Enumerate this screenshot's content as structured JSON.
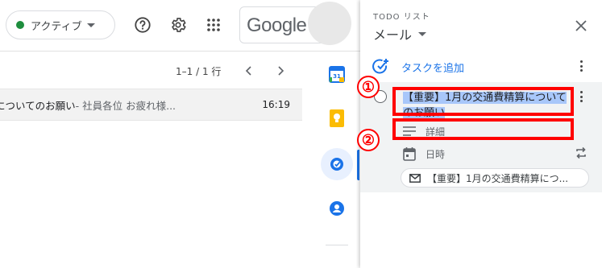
{
  "topbar": {
    "status_label": "アクティブ",
    "google_logo_text": "Google"
  },
  "mail": {
    "pager": "1–1 / 1 行",
    "row": {
      "subject": "についてのお願い",
      "snippet": " - 社員各位 お疲れ様...",
      "time": "16:19"
    }
  },
  "tasks_panel": {
    "overline": "TODO リスト",
    "list_name": "メール",
    "add_task_label": "タスクを追加",
    "task": {
      "title": "【重要】1月の交通費精算についてのお願い",
      "details_label": "詳細",
      "date_label": "日時",
      "linked_email": "【重要】1月の交通費精算につ..."
    }
  },
  "annotations": {
    "marker_1": "①",
    "marker_2": "②",
    "color": "#ff0000"
  },
  "colors": {
    "accent": "#1a73e8",
    "active_status": "#1e8e3e",
    "selection": "#a8c7fa"
  }
}
